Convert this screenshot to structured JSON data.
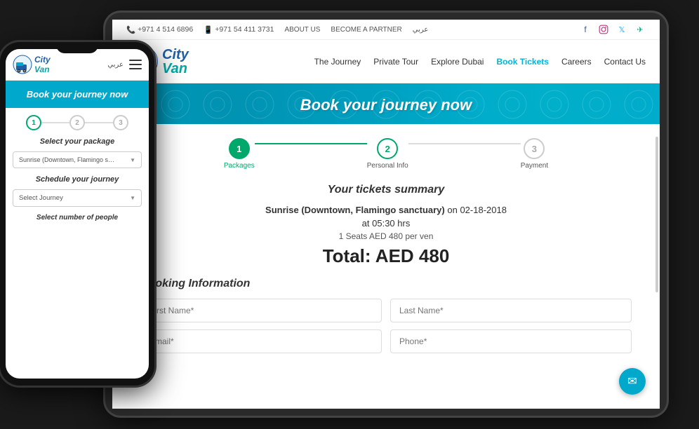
{
  "site": {
    "logo_text_city": "City",
    "logo_text_van": "Van",
    "logo_truck_color": "#1e5fa8"
  },
  "top_bar": {
    "phone1": "+971 4 514 6896",
    "phone2": "+971 54 411 3731",
    "about_us": "ABOUT US",
    "partner": "BECOME A PARTNER",
    "arabic": "عربي"
  },
  "nav": {
    "links": [
      {
        "label": "The Journey",
        "active": false
      },
      {
        "label": "Private Tour",
        "active": false
      },
      {
        "label": "Explore Dubai",
        "active": false
      },
      {
        "label": "Book Tickets",
        "active": true
      },
      {
        "label": "Careers",
        "active": false
      },
      {
        "label": "Contact Us",
        "active": false
      }
    ]
  },
  "hero": {
    "title": "Book your journey now"
  },
  "progress": {
    "steps": [
      {
        "number": "1",
        "label": "Packages",
        "state": "completed"
      },
      {
        "number": "2",
        "label": "Personal Info",
        "state": "active"
      },
      {
        "number": "3",
        "label": "Payment",
        "state": "inactive"
      }
    ]
  },
  "summary": {
    "title": "Your tickets summary",
    "journey_name": "Sunrise (Downtown, Flamingo sanctuary)",
    "date": "on 02-18-2018",
    "time": "at 05:30 hrs",
    "seats_info": "1 Seats AED 480 per ven",
    "total_label": "Total: AED 480"
  },
  "booking_info": {
    "title": "Booking Information",
    "first_name_placeholder": "First Name*",
    "last_name_placeholder": "Last Name*",
    "email_placeholder": "Email*",
    "phone_placeholder": "Phone*"
  },
  "mobile": {
    "arabic": "عربي",
    "hero_title": "Book your journey now",
    "package_section_title": "Select your package",
    "package_selected": "Sunrise (Downtown, Flamingo sanctuary)",
    "schedule_section_title": "Schedule your journey",
    "select_journey_label": "Select Journey",
    "bottom_text": "Select number of people"
  },
  "chat": {
    "icon": "✉"
  }
}
